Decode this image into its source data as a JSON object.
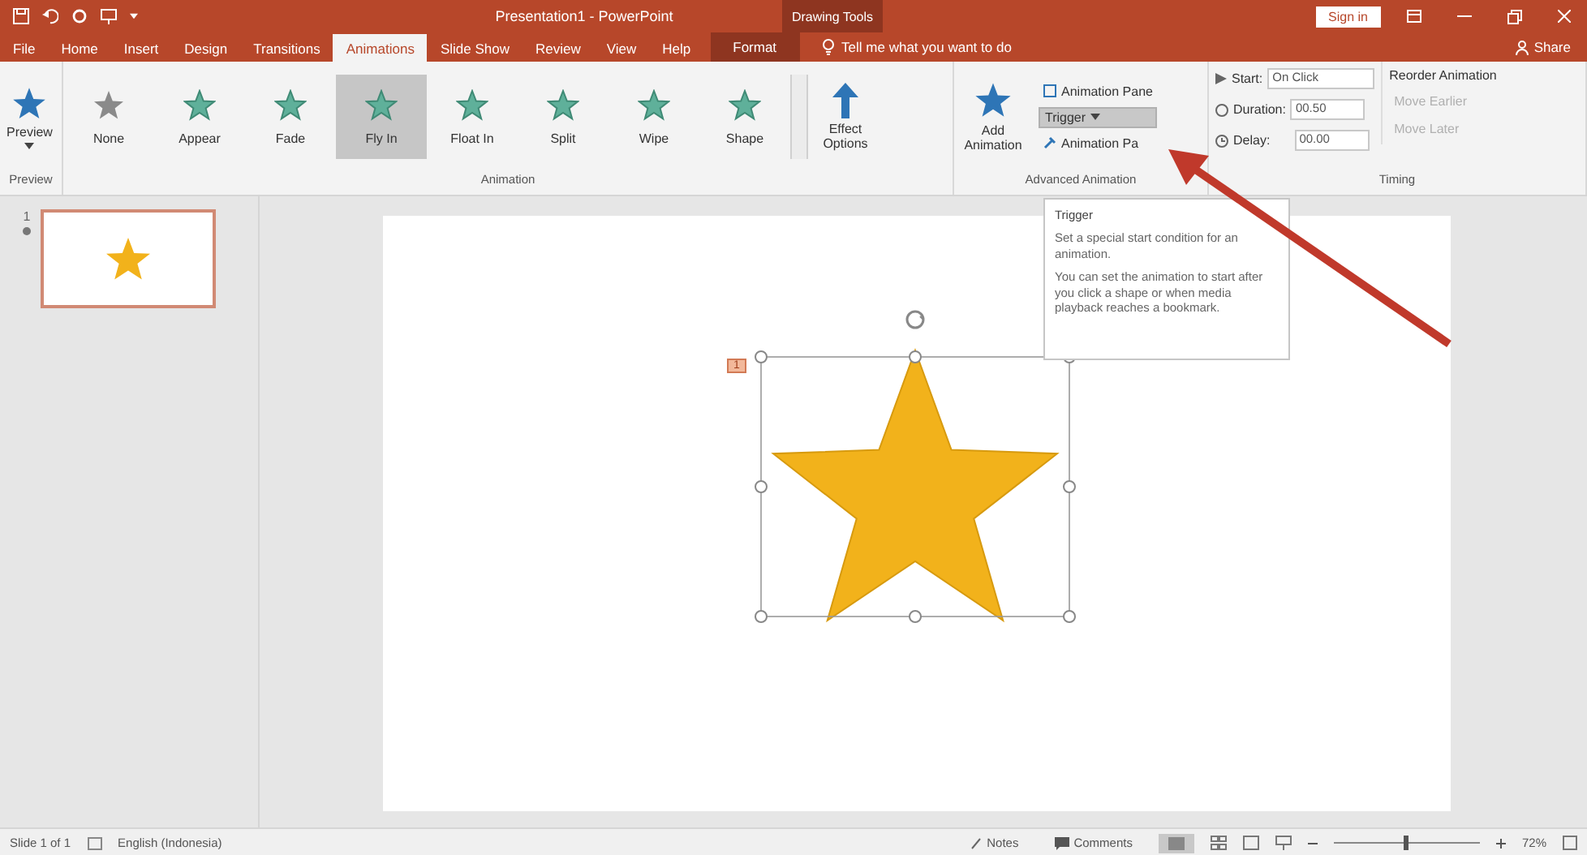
{
  "title_bar": {
    "title": "Presentation1 - PowerPoint",
    "context_label": "Drawing Tools",
    "sign_in": "Sign in"
  },
  "tabs": [
    {
      "label": "File",
      "selected": false,
      "kind": "normal"
    },
    {
      "label": "Home",
      "selected": false,
      "kind": "normal"
    },
    {
      "label": "Insert",
      "selected": false,
      "kind": "normal"
    },
    {
      "label": "Design",
      "selected": false,
      "kind": "normal"
    },
    {
      "label": "Transitions",
      "selected": false,
      "kind": "normal"
    },
    {
      "label": "Animations",
      "selected": true,
      "kind": "normal"
    },
    {
      "label": "Slide Show",
      "selected": false,
      "kind": "normal"
    },
    {
      "label": "Review",
      "selected": false,
      "kind": "normal"
    },
    {
      "label": "View",
      "selected": false,
      "kind": "normal"
    },
    {
      "label": "Help",
      "selected": false,
      "kind": "normal"
    },
    {
      "label": "Format",
      "selected": false,
      "kind": "context"
    }
  ],
  "tell_me": {
    "placeholder": "Tell me what you want to do"
  },
  "share": "Share",
  "ribbon": {
    "preview": {
      "label": "Preview",
      "group": "Preview"
    },
    "gallery": {
      "group": "Animation",
      "items": [
        {
          "label": "None",
          "kind": "none",
          "selected": false
        },
        {
          "label": "Appear",
          "kind": "effect",
          "selected": false
        },
        {
          "label": "Fade",
          "kind": "effect",
          "selected": false
        },
        {
          "label": "Fly In",
          "kind": "effect",
          "selected": true
        },
        {
          "label": "Float In",
          "kind": "effect",
          "selected": false
        },
        {
          "label": "Split",
          "kind": "effect",
          "selected": false
        },
        {
          "label": "Wipe",
          "kind": "effect",
          "selected": false
        },
        {
          "label": "Shape",
          "kind": "effect",
          "selected": false
        }
      ]
    },
    "effect_options": "Effect Options",
    "advanced": {
      "group": "Advanced Animation",
      "add": "Add Animation",
      "pane": "Animation Pane",
      "trigger": "Trigger",
      "trigger_pressed": true,
      "painter": "Animation Pa"
    },
    "timing": {
      "group": "Timing",
      "start_label": "Start:",
      "start_value": "On Click",
      "duration_label": "Duration:",
      "duration_value": "00.50",
      "delay_label": "Delay:",
      "delay_value": "00.00",
      "reorder": "Reorder Animation",
      "earlier": {
        "label": "Move Earlier",
        "disabled": true
      },
      "later": {
        "label": "Move Later",
        "disabled": true
      }
    }
  },
  "thumbnails": [
    {
      "number": "1",
      "selected": true
    }
  ],
  "slide": {
    "animation_badge": "1"
  },
  "tooltip": {
    "title": "Trigger",
    "line1": "Set a special start condition for an animation.",
    "line2": "You can set the animation to start after you click a shape or when media playback reaches a bookmark."
  },
  "status_bar": {
    "slide": "Slide 1 of 1",
    "language": "English (Indonesia)",
    "notes": "Notes",
    "comments": "Comments",
    "zoom": {
      "level": 0.5,
      "reading": "72%"
    }
  }
}
